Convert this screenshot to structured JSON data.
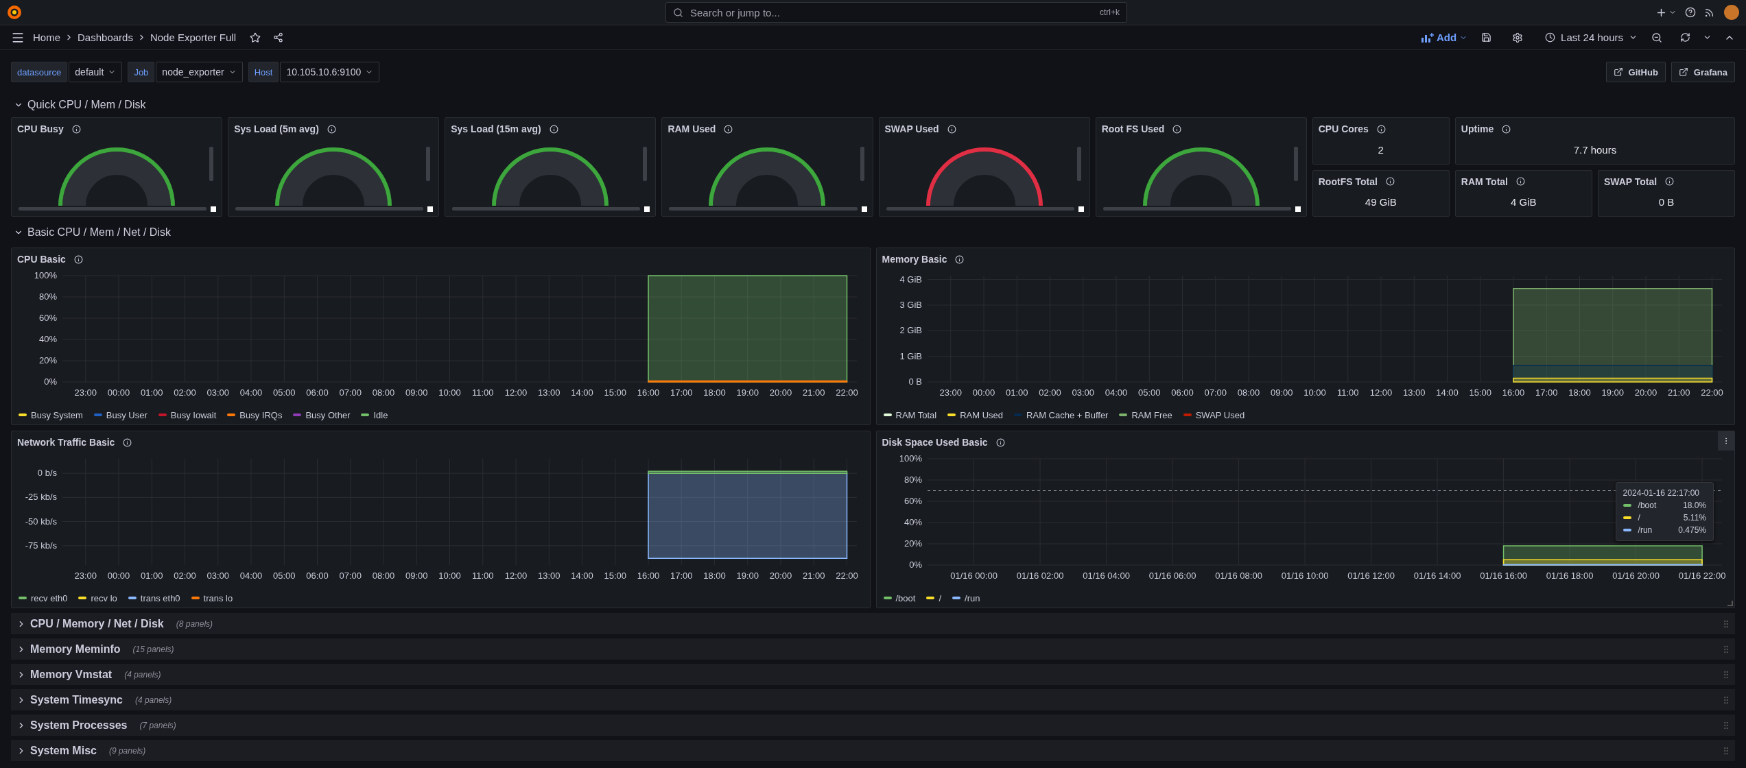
{
  "top_bar": {
    "search": {
      "placeholder": "Search or jump to...",
      "shortcut": "ctrl+k"
    }
  },
  "nav": {
    "breadcrumbs": [
      "Home",
      "Dashboards",
      "Node Exporter Full"
    ],
    "add_label": "Add",
    "time_range": "Last 24 hours"
  },
  "variables": [
    {
      "label": "datasource",
      "value": "default"
    },
    {
      "label": "Job",
      "value": "node_exporter"
    },
    {
      "label": "Host",
      "value": "10.105.10.6:9100"
    }
  ],
  "links": [
    "GitHub",
    "Grafana"
  ],
  "quick_row": {
    "title": "Quick CPU / Mem / Disk",
    "expanded": true
  },
  "gauges": [
    {
      "title": "CPU Busy",
      "color": "#3da63d"
    },
    {
      "title": "Sys Load (5m avg)",
      "color": "#3da63d"
    },
    {
      "title": "Sys Load (15m avg)",
      "color": "#3da63d"
    },
    {
      "title": "RAM Used",
      "color": "#3da63d"
    },
    {
      "title": "SWAP Used",
      "color": "#e02f44"
    },
    {
      "title": "Root FS Used",
      "color": "#3da63d"
    }
  ],
  "stats": [
    {
      "title": "CPU Cores",
      "value": "2"
    },
    {
      "title": "Uptime",
      "value": "7.7 hours"
    },
    {
      "title": "RootFS Total",
      "value": "49 GiB"
    },
    {
      "title": "RAM Total",
      "value": "4 GiB"
    },
    {
      "title": "SWAP Total",
      "value": "0 B"
    }
  ],
  "basic_row": {
    "title": "Basic CPU / Mem / Net / Disk",
    "expanded": true
  },
  "charts": [
    {
      "title": "CPU Basic",
      "chart_data": {
        "type": "area",
        "grid": true,
        "categories": [
          "23:00",
          "00:00",
          "01:00",
          "02:00",
          "03:00",
          "04:00",
          "05:00",
          "06:00",
          "07:00",
          "08:00",
          "09:00",
          "10:00",
          "11:00",
          "12:00",
          "13:00",
          "14:00",
          "15:00",
          "16:00",
          "17:00",
          "18:00",
          "19:00",
          "20:00",
          "21:00",
          "22:00"
        ],
        "ylim": [
          0,
          100
        ],
        "yticks": [
          {
            "value": 0,
            "label": "0%"
          },
          {
            "value": 20,
            "label": "20%"
          },
          {
            "value": 40,
            "label": "40%"
          },
          {
            "value": 60,
            "label": "60%"
          },
          {
            "value": 80,
            "label": "80%"
          },
          {
            "value": 100,
            "label": "100%"
          }
        ],
        "series": [
          {
            "name": "Busy System",
            "color": "#fade2a",
            "values": [
              null,
              null,
              null,
              null,
              null,
              null,
              null,
              null,
              null,
              null,
              null,
              null,
              null,
              null,
              null,
              null,
              null,
              null,
              null,
              null,
              null,
              null,
              null,
              null
            ]
          },
          {
            "name": "Busy User",
            "color": "#1f60c4",
            "values": [
              null,
              null,
              null,
              null,
              null,
              null,
              null,
              null,
              null,
              null,
              null,
              null,
              null,
              null,
              null,
              null,
              null,
              null,
              null,
              null,
              null,
              null,
              null,
              null
            ]
          },
          {
            "name": "Busy Iowait",
            "color": "#c4162a",
            "values": [
              null,
              null,
              null,
              null,
              null,
              null,
              null,
              null,
              null,
              null,
              null,
              null,
              null,
              null,
              null,
              null,
              null,
              null,
              null,
              null,
              null,
              null,
              null,
              null
            ]
          },
          {
            "name": "Busy IRQs",
            "color": "#ff780a",
            "values": [
              null,
              null,
              null,
              null,
              null,
              null,
              null,
              null,
              null,
              null,
              null,
              null,
              null,
              null,
              null,
              null,
              null,
              1,
              1,
              1,
              1,
              1,
              1,
              1
            ]
          },
          {
            "name": "Busy Other",
            "color": "#8f3bb8",
            "values": [
              null,
              null,
              null,
              null,
              null,
              null,
              null,
              null,
              null,
              null,
              null,
              null,
              null,
              null,
              null,
              null,
              null,
              null,
              null,
              null,
              null,
              null,
              null,
              null
            ]
          },
          {
            "name": "Idle",
            "color": "#73bf69",
            "values": [
              null,
              null,
              null,
              null,
              null,
              null,
              null,
              null,
              null,
              null,
              null,
              null,
              null,
              null,
              null,
              null,
              null,
              100,
              100,
              100,
              100,
              100,
              100,
              100
            ]
          }
        ]
      }
    },
    {
      "title": "Memory Basic",
      "chart_data": {
        "type": "area",
        "grid": true,
        "categories": [
          "23:00",
          "00:00",
          "01:00",
          "02:00",
          "03:00",
          "04:00",
          "05:00",
          "06:00",
          "07:00",
          "08:00",
          "09:00",
          "10:00",
          "11:00",
          "12:00",
          "13:00",
          "14:00",
          "15:00",
          "16:00",
          "17:00",
          "18:00",
          "19:00",
          "20:00",
          "21:00",
          "22:00"
        ],
        "ylim": [
          0,
          4.15
        ],
        "yticks": [
          {
            "value": 0,
            "label": "0 B"
          },
          {
            "value": 1,
            "label": "1 GiB"
          },
          {
            "value": 2,
            "label": "2 GiB"
          },
          {
            "value": 3,
            "label": "3 GiB"
          },
          {
            "value": 4,
            "label": "4 GiB"
          }
        ],
        "series": [
          {
            "name": "RAM Total",
            "color": "#e0f9d7",
            "values": [
              null,
              null,
              null,
              null,
              null,
              null,
              null,
              null,
              null,
              null,
              null,
              null,
              null,
              null,
              null,
              null,
              null,
              null,
              null,
              null,
              null,
              null,
              null,
              null
            ]
          },
          {
            "name": "RAM Used",
            "color": "#fade2a",
            "values": [
              null,
              null,
              null,
              null,
              null,
              null,
              null,
              null,
              null,
              null,
              null,
              null,
              null,
              null,
              null,
              null,
              null,
              0.15,
              0.15,
              0.15,
              0.15,
              0.15,
              0.15,
              0.15
            ]
          },
          {
            "name": "RAM Cache + Buffer",
            "color": "#052b51",
            "values": [
              null,
              null,
              null,
              null,
              null,
              null,
              null,
              null,
              null,
              null,
              null,
              null,
              null,
              null,
              null,
              null,
              null,
              0.65,
              0.65,
              0.65,
              0.65,
              0.65,
              0.65,
              0.65
            ]
          },
          {
            "name": "RAM Free",
            "color": "#7eb26d",
            "values": [
              null,
              null,
              null,
              null,
              null,
              null,
              null,
              null,
              null,
              null,
              null,
              null,
              null,
              null,
              null,
              null,
              null,
              3.65,
              3.65,
              3.65,
              3.65,
              3.65,
              3.65,
              3.65
            ]
          },
          {
            "name": "SWAP Used",
            "color": "#bf1b00",
            "values": [
              null,
              null,
              null,
              null,
              null,
              null,
              null,
              null,
              null,
              null,
              null,
              null,
              null,
              null,
              null,
              null,
              null,
              null,
              null,
              null,
              null,
              null,
              null,
              null
            ]
          }
        ]
      }
    },
    {
      "title": "Network Traffic Basic",
      "chart_data": {
        "type": "area",
        "grid": true,
        "categories": [
          "23:00",
          "00:00",
          "01:00",
          "02:00",
          "03:00",
          "04:00",
          "05:00",
          "06:00",
          "07:00",
          "08:00",
          "09:00",
          "10:00",
          "11:00",
          "12:00",
          "13:00",
          "14:00",
          "15:00",
          "16:00",
          "17:00",
          "18:00",
          "19:00",
          "20:00",
          "21:00",
          "22:00"
        ],
        "ylim": [
          -95,
          15
        ],
        "yticks": [
          {
            "value": 0,
            "label": "0 b/s"
          },
          {
            "value": -25,
            "label": "-25 kb/s"
          },
          {
            "value": -50,
            "label": "-50 kb/s"
          },
          {
            "value": -75,
            "label": "-75 kb/s"
          }
        ],
        "series": [
          {
            "name": "recv eth0",
            "color": "#73bf69",
            "values": [
              null,
              null,
              null,
              null,
              null,
              null,
              null,
              null,
              null,
              null,
              null,
              null,
              null,
              null,
              null,
              null,
              null,
              2,
              2,
              2,
              2,
              2,
              2,
              2
            ]
          },
          {
            "name": "recv lo",
            "color": "#fade2a",
            "values": [
              null,
              null,
              null,
              null,
              null,
              null,
              null,
              null,
              null,
              null,
              null,
              null,
              null,
              null,
              null,
              null,
              null,
              null,
              null,
              null,
              null,
              null,
              null,
              null
            ]
          },
          {
            "name": "trans eth0",
            "color": "#8ab8ff",
            "values": [
              null,
              null,
              null,
              null,
              null,
              null,
              null,
              null,
              null,
              null,
              null,
              null,
              null,
              null,
              null,
              null,
              null,
              -88,
              -88,
              -88,
              -88,
              -88,
              -88,
              -88
            ]
          },
          {
            "name": "trans lo",
            "color": "#ff780a",
            "values": [
              null,
              null,
              null,
              null,
              null,
              null,
              null,
              null,
              null,
              null,
              null,
              null,
              null,
              null,
              null,
              null,
              null,
              null,
              null,
              null,
              null,
              null,
              null,
              null
            ]
          }
        ]
      }
    },
    {
      "title": "Disk Space Used Basic",
      "chart_data": {
        "type": "area",
        "grid": true,
        "categories": [
          "01/16 00:00",
          "01/16 02:00",
          "01/16 04:00",
          "01/16 06:00",
          "01/16 08:00",
          "01/16 10:00",
          "01/16 12:00",
          "01/16 14:00",
          "01/16 16:00",
          "01/16 18:00",
          "01/16 20:00",
          "01/16 22:00"
        ],
        "ylim": [
          0,
          100
        ],
        "yticks": [
          {
            "value": 0,
            "label": "0%"
          },
          {
            "value": 20,
            "label": "20%"
          },
          {
            "value": 40,
            "label": "40%"
          },
          {
            "value": 60,
            "label": "60%"
          },
          {
            "value": 80,
            "label": "80%"
          },
          {
            "value": 100,
            "label": "100%"
          }
        ],
        "ref_lines": [
          {
            "axis": "y",
            "value": 70
          }
        ],
        "series": [
          {
            "name": "/boot",
            "color": "#73bf69",
            "values": [
              null,
              null,
              null,
              null,
              null,
              null,
              null,
              null,
              18,
              18,
              18,
              18
            ]
          },
          {
            "name": "/",
            "color": "#fade2a",
            "values": [
              null,
              null,
              null,
              null,
              null,
              null,
              null,
              null,
              5,
              5,
              5,
              5
            ]
          },
          {
            "name": "/run",
            "color": "#8ab8ff",
            "values": [
              null,
              null,
              null,
              null,
              null,
              null,
              null,
              null,
              0.5,
              0.5,
              0.5,
              0.5
            ]
          }
        ]
      },
      "tooltip": {
        "time": "2024-01-16 22:17:00",
        "rows": [
          {
            "label": "/boot",
            "value": "18.0%",
            "color": "#73bf69"
          },
          {
            "label": "/",
            "value": "5.11%",
            "color": "#fade2a"
          },
          {
            "label": "/run",
            "value": "0.475%",
            "color": "#8ab8ff"
          }
        ]
      }
    }
  ],
  "collapsed_rows": [
    {
      "title": "CPU / Memory / Net / Disk",
      "count": "(8 panels)",
      "expanded": false
    },
    {
      "title": "Memory Meminfo",
      "count": "(15 panels)",
      "expanded": false
    },
    {
      "title": "Memory Vmstat",
      "count": "(4 panels)",
      "expanded": false
    },
    {
      "title": "System Timesync",
      "count": "(4 panels)",
      "expanded": false
    },
    {
      "title": "System Processes",
      "count": "(7 panels)",
      "expanded": false
    },
    {
      "title": "System Misc",
      "count": "(9 panels)",
      "expanded": false
    }
  ]
}
